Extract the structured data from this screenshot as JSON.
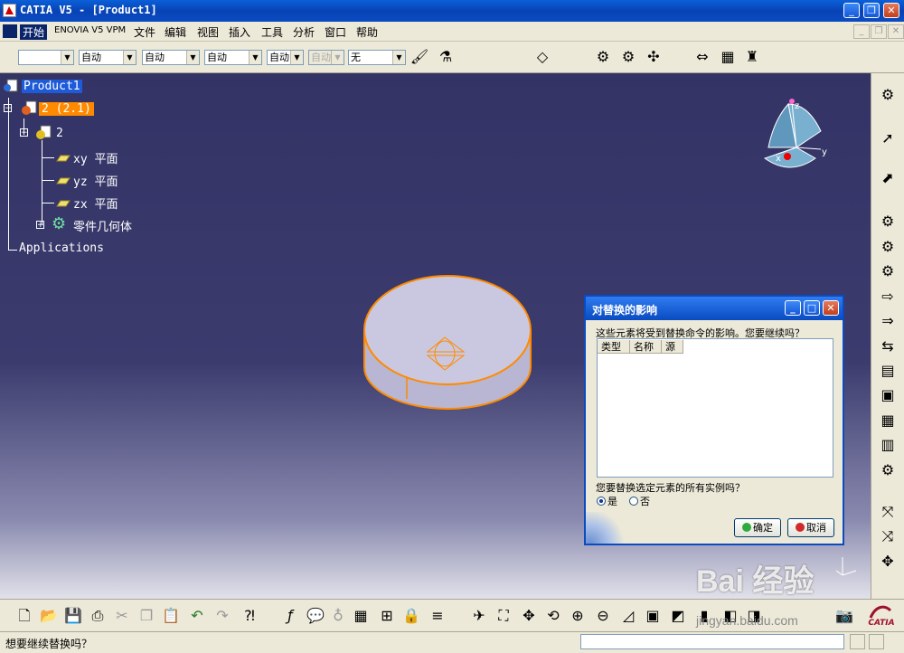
{
  "window": {
    "title": "CATIA V5 - [Product1]",
    "minimize": "_",
    "maximize": "❐",
    "close": "✕"
  },
  "menubar": {
    "items": [
      "开始",
      "ENOVIA V5 VPM",
      "文件",
      "编辑",
      "视图",
      "插入",
      "工具",
      "分析",
      "窗口",
      "帮助"
    ],
    "mdi_min": "_",
    "mdi_restore": "❐",
    "mdi_close": "✕"
  },
  "toolbar1": {
    "combos": [
      "",
      "自动",
      "自动",
      "自动",
      "自动",
      "自动",
      "无"
    ]
  },
  "tree": {
    "root": "Product1",
    "instance": "2 (2.1)",
    "part": "2",
    "planes": [
      "xy 平面",
      "yz 平面",
      "zx 平面"
    ],
    "body": "零件几何体",
    "applications": "Applications"
  },
  "compass": {
    "x": "x",
    "y": "y",
    "z": "z"
  },
  "dialog": {
    "title": "对替换的影响",
    "message": "这些元素将受到替换命令的影响。您要继续吗？",
    "columns": [
      "类型",
      "名称",
      "源"
    ],
    "question": "您要替换选定元素的所有实例吗？",
    "option_yes": "是",
    "option_no": "否",
    "selected": "是",
    "ok": "确定",
    "cancel": "取消"
  },
  "statusbar": {
    "message": "想要继续替换吗？"
  },
  "watermark": {
    "brand": "Bai 经验",
    "url": "jingyan.baidu.com"
  },
  "colors": {
    "viewport_top": "#333366",
    "selection_orange": "#ff8a00",
    "title_blue": "#0a4bc2"
  }
}
